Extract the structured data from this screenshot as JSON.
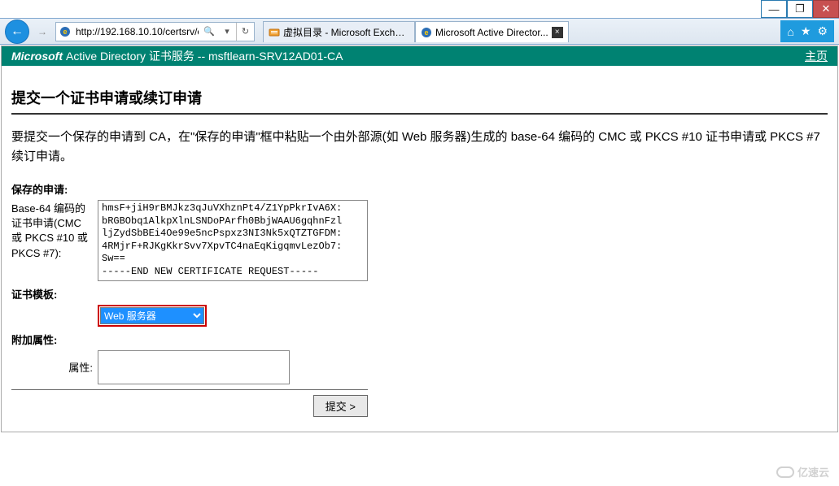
{
  "window": {
    "minimize": "—",
    "maximize": "❐",
    "close": "✕"
  },
  "browser": {
    "url": "http://192.168.10.10/certsrv/ce",
    "search_glyph": "🔍",
    "refresh_glyph": "↻",
    "back_glyph": "←",
    "fwd_glyph": "→"
  },
  "tabs": [
    {
      "icon": "🗂",
      "title": "虚拟目录 - Microsoft Exchan...",
      "active": false,
      "close": ""
    },
    {
      "icon": "e",
      "title": "Microsoft Active Director...",
      "active": true,
      "close": "×"
    }
  ],
  "chrome_icons": {
    "home": "⌂",
    "star": "★",
    "gear": "⚙"
  },
  "banner": {
    "brand": "Microsoft",
    "service": " Active Directory 证书服务  --  msftlearn-SRV12AD01-CA",
    "home_link": "主页"
  },
  "page": {
    "title": "提交一个证书申请或续订申请",
    "description": "要提交一个保存的申请到 CA，在\"保存的申请\"框中粘贴一个由外部源(如 Web 服务器)生成的 base-64 编码的 CMC 或 PKCS #10 证书申请或 PKCS #7 续订申请。"
  },
  "saved_request": {
    "section_label": "保存的申请:",
    "field_label": "Base-64 编码的证书申请(CMC 或 PKCS #10 或 PKCS #7):",
    "value": "hmsF+jiH9rBMJkz3qJuVXhznPt4/Z1YpPkrIvA6X:\nbRGBObq1AlkpXlnLSNDoPArfh0BbjWAAU6gqhnFzl\nljZydSbBEi4Oe99e5ncPspxz3NI3Nk5xQTZTGFDM:\n4RMjrF+RJKgKkrSvv7XpvTC4naEqKigqmvLezOb7:\nSw==\n-----END NEW CERTIFICATE REQUEST-----"
  },
  "template": {
    "section_label": "证书模板:",
    "selected": "Web 服务器",
    "options": [
      "Web 服务器"
    ]
  },
  "attributes": {
    "section_label": "附加属性:",
    "field_label": "属性:",
    "value": ""
  },
  "submit": {
    "label": "提交 >"
  },
  "watermark": "亿速云"
}
